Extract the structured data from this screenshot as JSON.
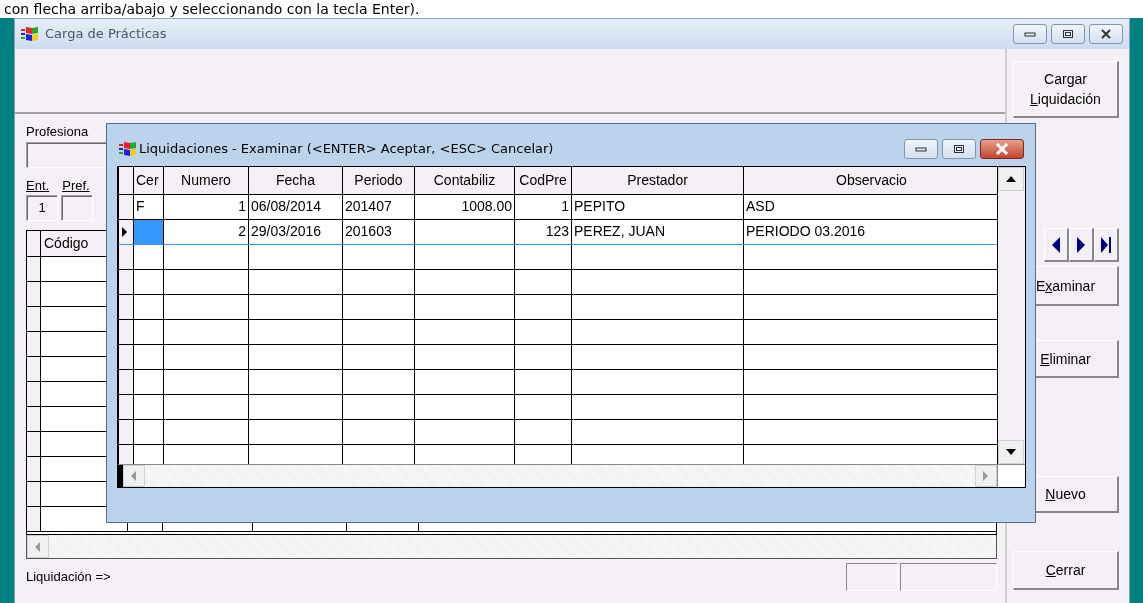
{
  "caption_fragment": "con flecha arriba/abajo y seleccionando con la tecla Enter).",
  "main_window": {
    "title": "Carga de Prácticas",
    "profesional_label": "Profesiona",
    "ent_label": "Ent.",
    "pref_label": "Pref.",
    "ent_value": "1",
    "grid": {
      "columns": [
        "Código"
      ]
    },
    "status_label": "Liquidación =>",
    "buttons": [
      {
        "kind": "text",
        "before": "Cargar\n",
        "access_key": "L",
        "after": "iquidación"
      },
      {
        "kind": "nav"
      },
      {
        "kind": "text",
        "before": "E",
        "access_key": "x",
        "after": "aminar"
      },
      {
        "kind": "text",
        "access_key": "E",
        "after": "liminar"
      },
      {
        "kind": "text",
        "access_key": "N",
        "after": "uevo"
      },
      {
        "kind": "text",
        "access_key": "C",
        "after": "errar"
      }
    ]
  },
  "dialog": {
    "title": "Liquidaciones - Examinar (<ENTER> Aceptar, <ESC> Cancelar)",
    "columns": [
      "Cer",
      "Numero",
      "Fecha",
      "Periodo",
      "Contabiliz",
      "CodPre",
      "Prestador",
      "Observacio"
    ],
    "rows": [
      {
        "selected": false,
        "cells": [
          "F",
          "1",
          "06/08/2014",
          "201407",
          "1008.00",
          "1",
          "PEPITO",
          "ASD"
        ]
      },
      {
        "selected": true,
        "cells": [
          "",
          "2",
          "29/03/2016",
          "201603",
          "",
          "123",
          "PEREZ, JUAN",
          "PERIODO 03.2016"
        ]
      }
    ]
  }
}
